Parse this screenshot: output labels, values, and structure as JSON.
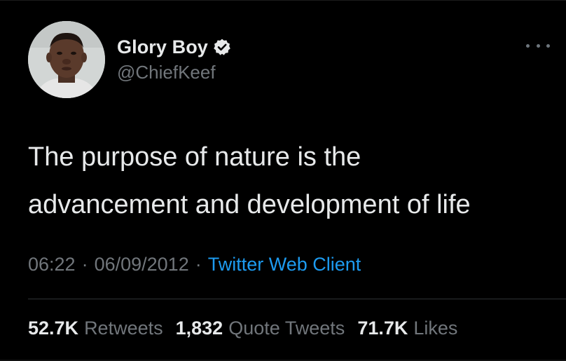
{
  "user": {
    "display_name": "Glory Boy",
    "handle": "@ChiefKeef",
    "verified": true
  },
  "tweet": {
    "lines": [
      "The purpose of nature is the",
      "advancement and development of life"
    ]
  },
  "meta": {
    "time": "06:22",
    "separator": "·",
    "date": "06/09/2012",
    "client": "Twitter Web Client"
  },
  "stats": {
    "retweets_count": "52.7K",
    "retweets_label": "Retweets",
    "quotes_count": "1,832",
    "quotes_label": "Quote Tweets",
    "likes_count": "71.7K",
    "likes_label": "Likes"
  },
  "colors": {
    "background": "#000000",
    "text": "#e7e9ea",
    "secondary": "#71767b",
    "link": "#1d9bf0",
    "divider": "#2f3336"
  },
  "icons": {
    "verified": "verified-badge-icon",
    "more": "more-options-icon"
  }
}
